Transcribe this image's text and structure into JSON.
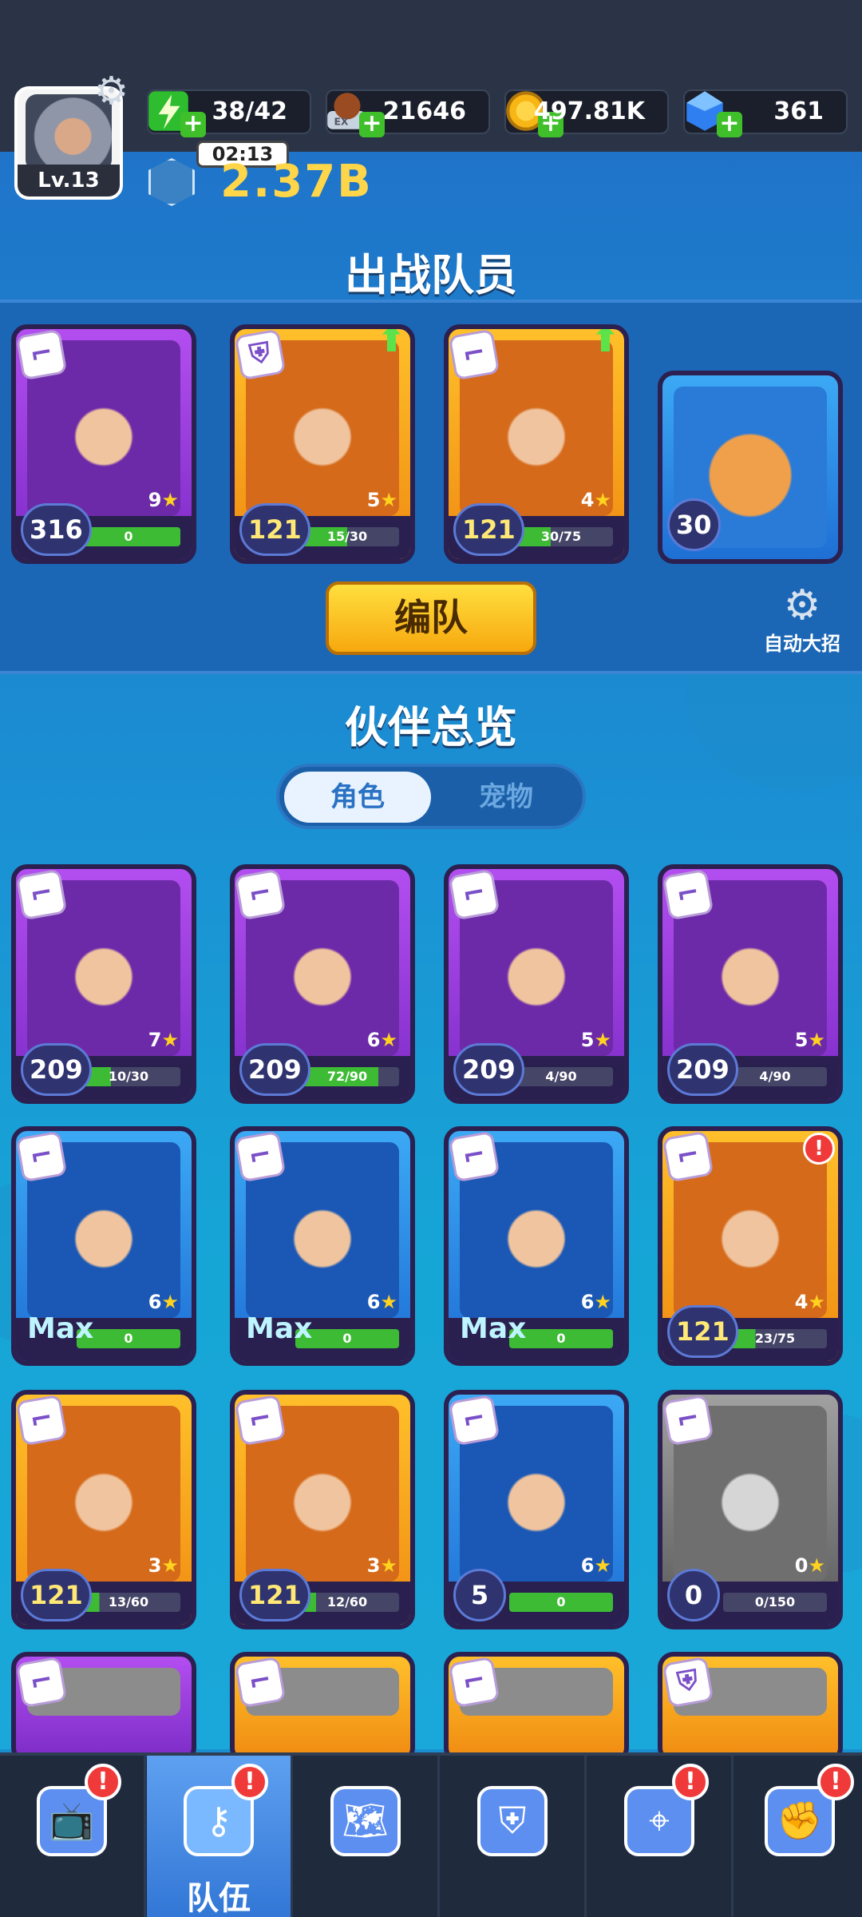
{
  "header": {
    "level": "Lv.13",
    "energy": "38/42",
    "timer": "02:13",
    "exp_food": "21646",
    "gold": "497.81K",
    "gems": "361",
    "power": "2.37B"
  },
  "team": {
    "title": "出战队员",
    "button": "编队",
    "auto_skill": "自动大招",
    "members": [
      {
        "level": "316",
        "stars": "9",
        "progress": "0",
        "rarity": "purple"
      },
      {
        "level": "121",
        "stars": "5",
        "progress": "15/30",
        "rarity": "orange",
        "upgrade": true
      },
      {
        "level": "121",
        "stars": "4",
        "progress": "30/75",
        "rarity": "orange",
        "upgrade": true
      },
      {
        "level": "30",
        "rarity": "blue",
        "pet": true
      }
    ]
  },
  "roster": {
    "title": "伙伴总览",
    "tabs": [
      "角色",
      "宠物"
    ],
    "active_tab": "角色",
    "cards": [
      {
        "level": "209",
        "stars": "7",
        "progress": "10/30",
        "rarity": "purple",
        "fill": 0.33
      },
      {
        "level": "209",
        "stars": "6",
        "progress": "72/90",
        "rarity": "purple",
        "fill": 0.8
      },
      {
        "level": "209",
        "stars": "5",
        "progress": "4/90",
        "rarity": "purple",
        "fill": 0.05
      },
      {
        "level": "209",
        "stars": "5",
        "progress": "4/90",
        "rarity": "purple",
        "fill": 0.05
      },
      {
        "level": "Max",
        "stars": "6",
        "progress": "0",
        "rarity": "blue",
        "fill": 1
      },
      {
        "level": "Max",
        "stars": "6",
        "progress": "0",
        "rarity": "blue",
        "fill": 1
      },
      {
        "level": "Max",
        "stars": "6",
        "progress": "0",
        "rarity": "blue",
        "fill": 1
      },
      {
        "level": "121",
        "stars": "4",
        "progress": "23/75",
        "rarity": "orange",
        "fill": 0.31,
        "alert": true
      },
      {
        "level": "121",
        "stars": "3",
        "progress": "13/60",
        "rarity": "orange",
        "fill": 0.22
      },
      {
        "level": "121",
        "stars": "3",
        "progress": "12/60",
        "rarity": "orange",
        "fill": 0.2
      },
      {
        "level": "5",
        "stars": "6",
        "progress": "0",
        "rarity": "blue",
        "fill": 1
      },
      {
        "level": "0",
        "stars": "0",
        "progress": "0/150",
        "rarity": "gray",
        "fill": 0
      }
    ]
  },
  "nav": {
    "active_label": "队伍",
    "alert_mark": "!"
  },
  "icons": {
    "energy": "lightning-icon",
    "exp": "exp-food-icon",
    "gold": "gold-coin-icon",
    "gem": "blue-gem-icon",
    "settings": "gear-icon"
  },
  "colors": {
    "accent_gold": "#ffd64a",
    "progress_green": "#3dbb34",
    "alert_red": "#f03a3a"
  }
}
